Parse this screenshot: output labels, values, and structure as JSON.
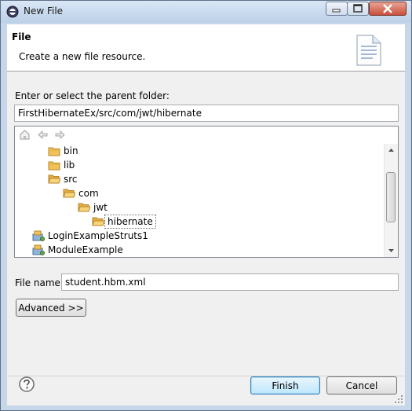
{
  "window": {
    "title": "New File"
  },
  "header": {
    "title": "File",
    "description": "Create a new file resource."
  },
  "parent_folder": {
    "label": "Enter or select the parent folder:",
    "value": "FirstHibernateEx/src/com/jwt/hibernate"
  },
  "tree": {
    "toolbar": {
      "home_icon": "home-icon",
      "back_icon": "back-arrow-icon",
      "forward_icon": "forward-arrow-icon"
    },
    "items": [
      {
        "label": "bin",
        "icon": "folder-icon"
      },
      {
        "label": "lib",
        "icon": "folder-icon"
      },
      {
        "label": "src",
        "icon": "folder-open-icon"
      },
      {
        "label": "com",
        "icon": "folder-open-icon"
      },
      {
        "label": "jwt",
        "icon": "folder-open-icon"
      },
      {
        "label": "hibernate",
        "icon": "folder-open-icon",
        "selected": true
      },
      {
        "label": "LoginExampleStruts1",
        "icon": "project-icon"
      },
      {
        "label": "ModuleExample",
        "icon": "project-icon"
      }
    ]
  },
  "file_name": {
    "label": "File name:",
    "value": "student.hbm.xml"
  },
  "buttons": {
    "advanced": "Advanced >>",
    "finish": "Finish",
    "cancel": "Cancel"
  },
  "colors": {
    "accent": "#3c7fb1",
    "folder": "#f2c25a",
    "selection_border": "#6e6e6e"
  }
}
